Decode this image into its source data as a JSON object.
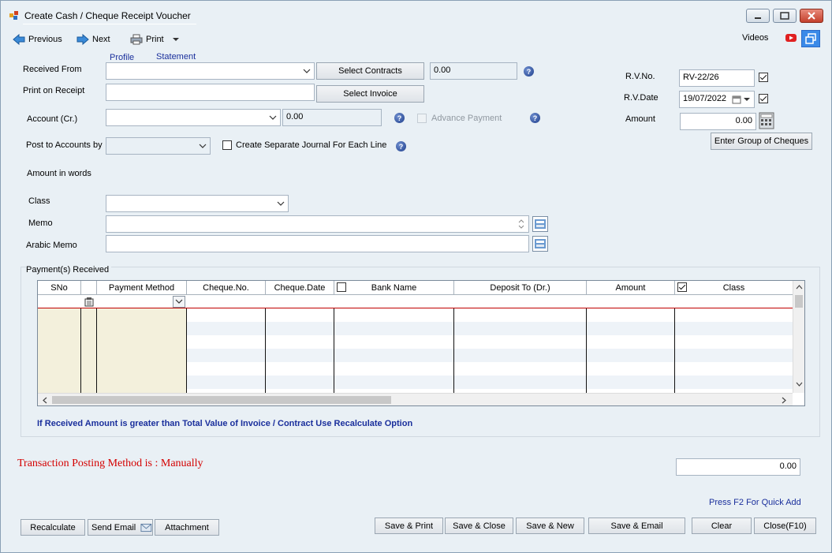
{
  "window": {
    "title": "Create Cash / Cheque Receipt Voucher"
  },
  "toolbar": {
    "previous": "Previous",
    "next": "Next",
    "print": "Print",
    "videos": "Videos"
  },
  "links": {
    "profile": "Profile",
    "statement": "Statement"
  },
  "form": {
    "received_from_label": "Received From",
    "received_from_value": "",
    "select_contracts": "Select Contracts",
    "contracts_amount": "0.00",
    "print_on_receipt_label": "Print on Receipt",
    "print_on_receipt_value": "",
    "select_invoice": "Select Invoice",
    "account_label": "Account (Cr.)",
    "account_value": "",
    "account_amount": "0.00",
    "advance_payment": "Advance Payment",
    "post_to_accounts_label": "Post to Accounts by",
    "post_to_accounts_value": "",
    "separate_journal": "Create Separate Journal For Each Line",
    "amount_in_words_label": "Amount in words",
    "class_label": "Class",
    "class_value": "",
    "memo_label": "Memo",
    "memo_value": "",
    "arabic_memo_label": "Arabic Memo",
    "arabic_memo_value": ""
  },
  "voucher": {
    "rv_no_label": "R.V.No.",
    "rv_no_value": "RV-22/26",
    "rv_date_label": "R.V.Date",
    "rv_date_value": "19/07/2022",
    "amount_label": "Amount",
    "amount_value": "0.00",
    "enter_group_cheques": "Enter Group of Cheques"
  },
  "payments": {
    "group_label": "Payment(s) Received",
    "columns": [
      "SNo",
      "Payment Method",
      "Cheque.No.",
      "Cheque.Date",
      "Bank Name",
      "Deposit To (Dr.)",
      "Amount",
      "Class"
    ],
    "note": "If Received Amount is greater than Total Value of Invoice / Contract Use Recalculate Option"
  },
  "status": {
    "posting_method": "Transaction Posting Method is : Manually",
    "total": "0.00",
    "hint": "Press F2 For Quick Add"
  },
  "buttons": {
    "recalculate": "Recalculate",
    "send_email": "Send Email",
    "attachment": "Attachment",
    "save_print": "Save & Print",
    "save_close": "Save & Close",
    "save_new": "Save & New",
    "save_email": "Save & Email",
    "clear": "Clear",
    "close": "Close(F10)"
  },
  "colors": {
    "window_bg": "#e9f0f5",
    "link_blue": "#1a2f9c",
    "posting_red": "#d40000",
    "grid_fixed_bg": "#f3f0dc",
    "grid_active_line": "#c00000"
  }
}
